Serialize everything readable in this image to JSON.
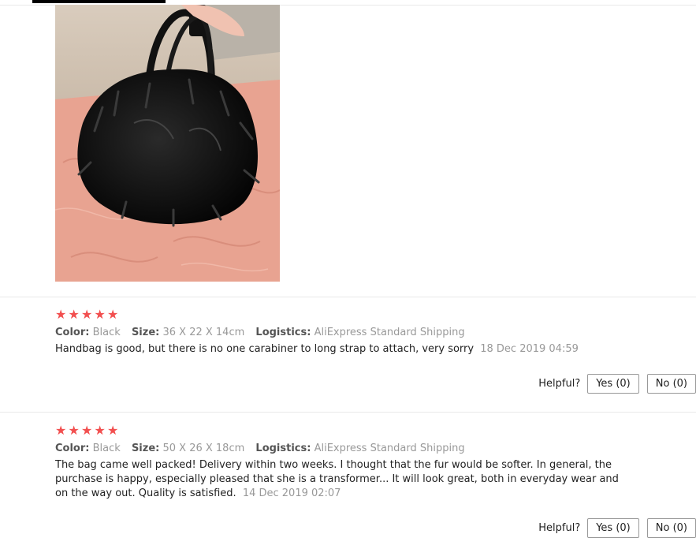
{
  "colors": {
    "star": "#f24f4f",
    "label": "#555555",
    "muted": "#999999",
    "text": "#222222"
  },
  "photo": {
    "icon": "review-photo-fur-handbag"
  },
  "reviews": [
    {
      "stars": [
        "★",
        "★",
        "★",
        "★",
        "★"
      ],
      "rating": 5,
      "color_label": "Color:",
      "color_value": "Black",
      "size_label": "Size:",
      "size_value": "36 X 22 X 14cm",
      "logistics_label": "Logistics:",
      "logistics_value": "AliExpress Standard Shipping",
      "text": "Handbag is good, but there is no one carabiner to long strap to attach, very sorry",
      "date": "18 Dec 2019 04:59",
      "helpful_label": "Helpful?",
      "yes_label": "Yes (0)",
      "no_label": "No (0)"
    },
    {
      "stars": [
        "★",
        "★",
        "★",
        "★",
        "★"
      ],
      "rating": 5,
      "color_label": "Color:",
      "color_value": "Black",
      "size_label": "Size:",
      "size_value": "50 X 26 X 18cm",
      "logistics_label": "Logistics:",
      "logistics_value": "AliExpress Standard Shipping",
      "text": "The bag came well packed! Delivery within two weeks. I thought that the fur would be softer. In general, the purchase is happy, especially pleased that she is a transformer... It will look great, both in everyday wear and on the way out. Quality is satisfied.",
      "date": "14 Dec 2019 02:07",
      "helpful_label": "Helpful?",
      "yes_label": "Yes (0)",
      "no_label": "No (0)"
    }
  ]
}
